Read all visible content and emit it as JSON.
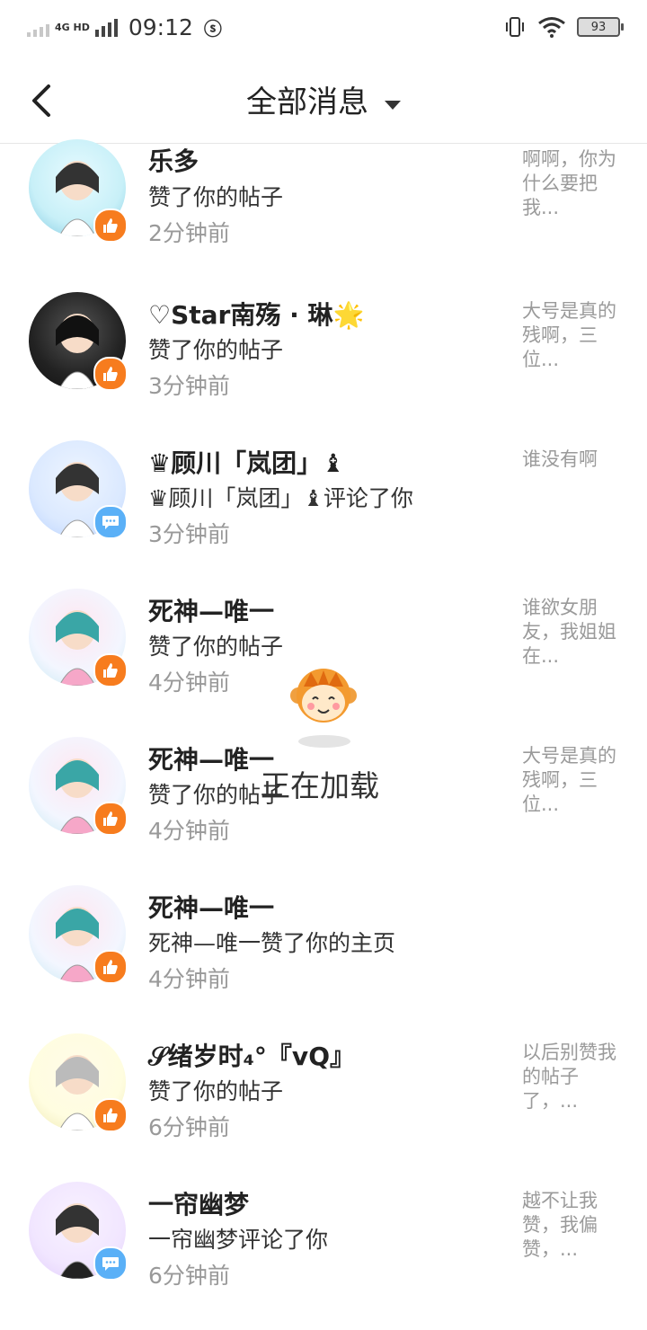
{
  "status_bar": {
    "network": "4G HD",
    "time": "09:12",
    "battery": "93"
  },
  "header": {
    "title": "全部消息"
  },
  "messages": [
    {
      "name": "乐多",
      "action": "赞了你的帖子",
      "time": "2分钟前",
      "preview": "啊啊，你为什么要把我...",
      "badge": "like"
    },
    {
      "name": "♡Star南殇 · 琳🌟",
      "action": "赞了你的帖子",
      "time": "3分钟前",
      "preview": "大号是真的残啊，三位...",
      "badge": "like"
    },
    {
      "name": "♛顾川「岚团」♝",
      "action": "♛顾川「岚团」♝评论了你",
      "time": "3分钟前",
      "preview": "谁没有啊",
      "badge": "comment"
    },
    {
      "name": "死神—唯一",
      "action": "赞了你的帖子",
      "time": "4分钟前",
      "preview": "谁欲女朋友，我姐姐在...",
      "badge": "like"
    },
    {
      "name": "死神—唯一",
      "action": "赞了你的帖子",
      "time": "4分钟前",
      "preview": "大号是真的残啊，三位...",
      "badge": "like"
    },
    {
      "name": "死神—唯一",
      "action": "死神—唯一赞了你的主页",
      "time": "4分钟前",
      "preview": "",
      "badge": "like"
    },
    {
      "name": "𝒮绪岁时₄°『vQ』",
      "action": "赞了你的帖子",
      "time": "6分钟前",
      "preview": "以后别赞我的帖子了，...",
      "badge": "like"
    },
    {
      "name": "一帘幽梦",
      "action": "一帘幽梦评论了你",
      "time": "6分钟前",
      "preview": "越不让我赞，我偏赞，...",
      "badge": "comment"
    }
  ],
  "loading": {
    "text": "正在加载"
  },
  "colors": {
    "like_badge": "#f77c1e",
    "comment_badge": "#5ab0f7",
    "muted_text": "#999999"
  }
}
